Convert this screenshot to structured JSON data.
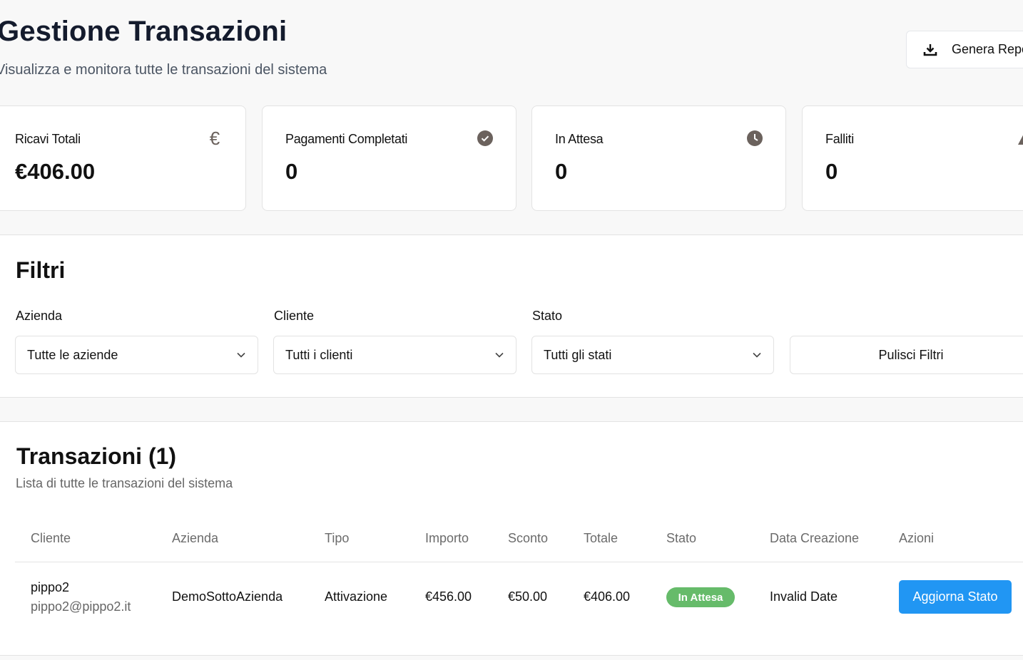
{
  "header": {
    "title": "Gestione Transazioni",
    "subtitle": "Visualizza e monitora tutte le transazioni del sistema",
    "report_button": "Genera Report"
  },
  "stats": [
    {
      "label": "Ricavi Totali",
      "value": "€406.00",
      "icon": "euro-icon"
    },
    {
      "label": "Pagamenti Completati",
      "value": "0",
      "icon": "check-circle-icon"
    },
    {
      "label": "In Attesa",
      "value": "0",
      "icon": "clock-icon"
    },
    {
      "label": "Falliti",
      "value": "0",
      "icon": "warning-icon"
    }
  ],
  "filters": {
    "title": "Filtri",
    "company_label": "Azienda",
    "company_value": "Tutte le aziende",
    "client_label": "Cliente",
    "client_value": "Tutti i clienti",
    "status_label": "Stato",
    "status_value": "Tutti gli stati",
    "clear_button": "Pulisci Filtri"
  },
  "transactions": {
    "title": "Transazioni (1)",
    "description": "Lista di tutte le transazioni del sistema",
    "columns": [
      "Cliente",
      "Azienda",
      "Tipo",
      "Importo",
      "Sconto",
      "Totale",
      "Stato",
      "Data Creazione",
      "Azioni"
    ],
    "rows": [
      {
        "client_name": "pippo2",
        "client_email": "pippo2@pippo2.it",
        "company": "DemoSottoAzienda",
        "type": "Attivazione",
        "amount": "€456.00",
        "discount": "€50.00",
        "total": "€406.00",
        "status": "In Attesa",
        "created": "Invalid Date",
        "action": "Aggiorna Stato"
      }
    ]
  },
  "colors": {
    "accent": "#2196f3",
    "pending_badge": "#66bb6a",
    "icon_gray": "#6b625d"
  }
}
